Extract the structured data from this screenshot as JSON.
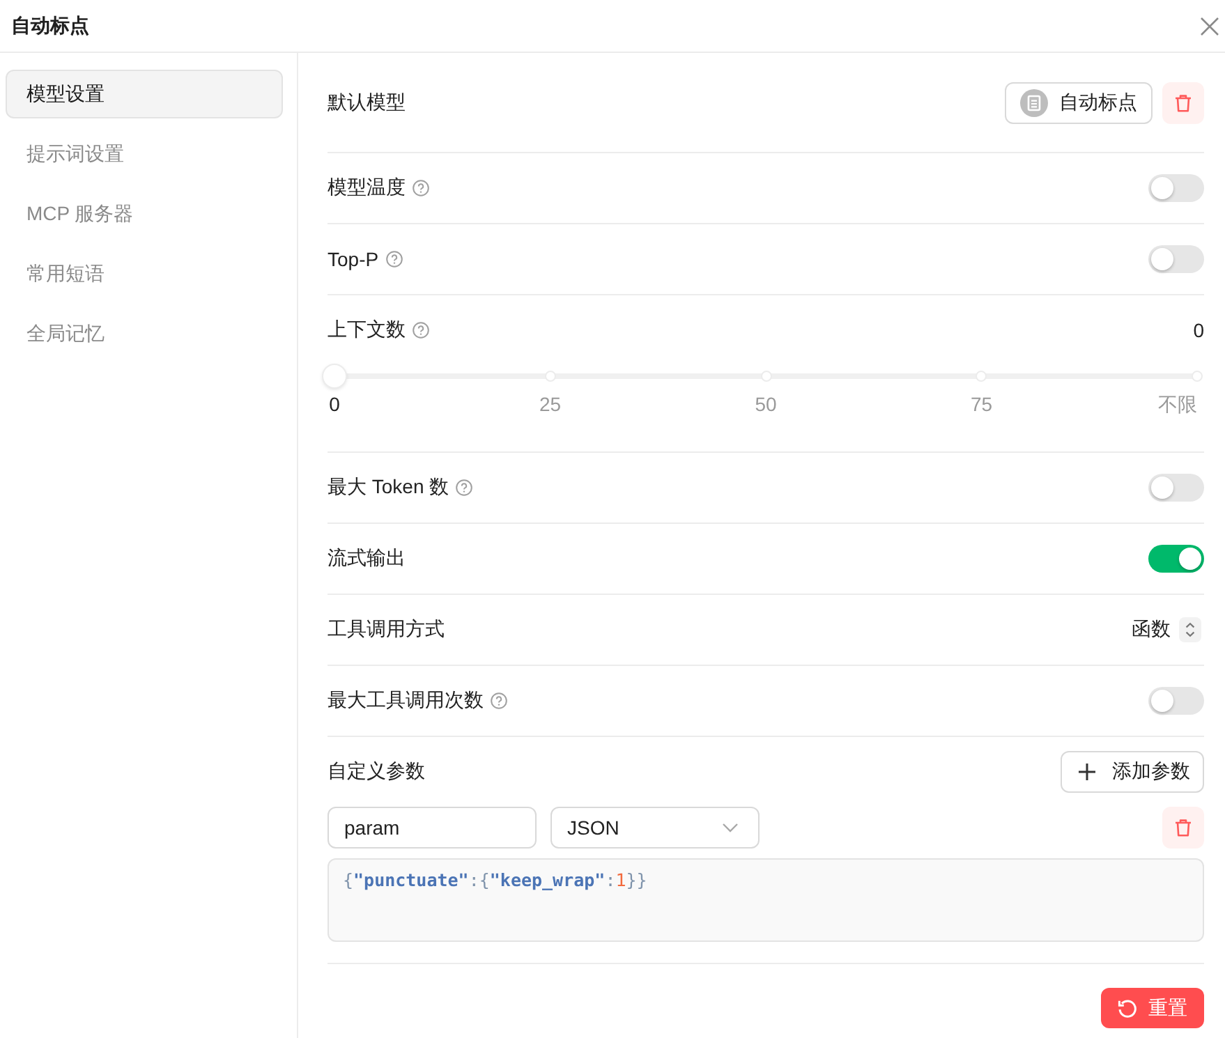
{
  "dialog": {
    "title": "自动标点"
  },
  "sidebar": {
    "items": [
      {
        "label": "模型设置",
        "selected": true
      },
      {
        "label": "提示词设置",
        "selected": false
      },
      {
        "label": "MCP 服务器",
        "selected": false
      },
      {
        "label": "常用短语",
        "selected": false
      },
      {
        "label": "全局记忆",
        "selected": false
      }
    ]
  },
  "settings": [
    {
      "kind": "model",
      "label": "默认模型",
      "help": false,
      "model": "自动标点"
    },
    {
      "kind": "toggle",
      "label": "模型温度",
      "help": true,
      "on": false
    },
    {
      "kind": "toggle",
      "label": "Top-P",
      "help": true,
      "on": false
    },
    {
      "kind": "slider",
      "label": "上下文数",
      "help": true,
      "reading": "0",
      "level": 0,
      "marks": [
        "0",
        "25",
        "50",
        "75",
        "不限"
      ]
    },
    {
      "kind": "toggle",
      "label": "最大 Token 数",
      "help": true,
      "on": false
    },
    {
      "kind": "toggle",
      "label": "流式输出",
      "help": false,
      "on": true
    },
    {
      "kind": "select",
      "label": "工具调用方式",
      "help": false,
      "value": "函数"
    },
    {
      "kind": "toggle",
      "label": "最大工具调用次数",
      "help": true,
      "on": false
    }
  ],
  "custom_params": {
    "label": "自定义参数",
    "add_button": "添加参数",
    "params": [
      {
        "name": "param",
        "type": "JSON",
        "value": "{\"punctuate\":{\"keep_wrap\":1}}"
      }
    ]
  },
  "reset_button": "重置"
}
